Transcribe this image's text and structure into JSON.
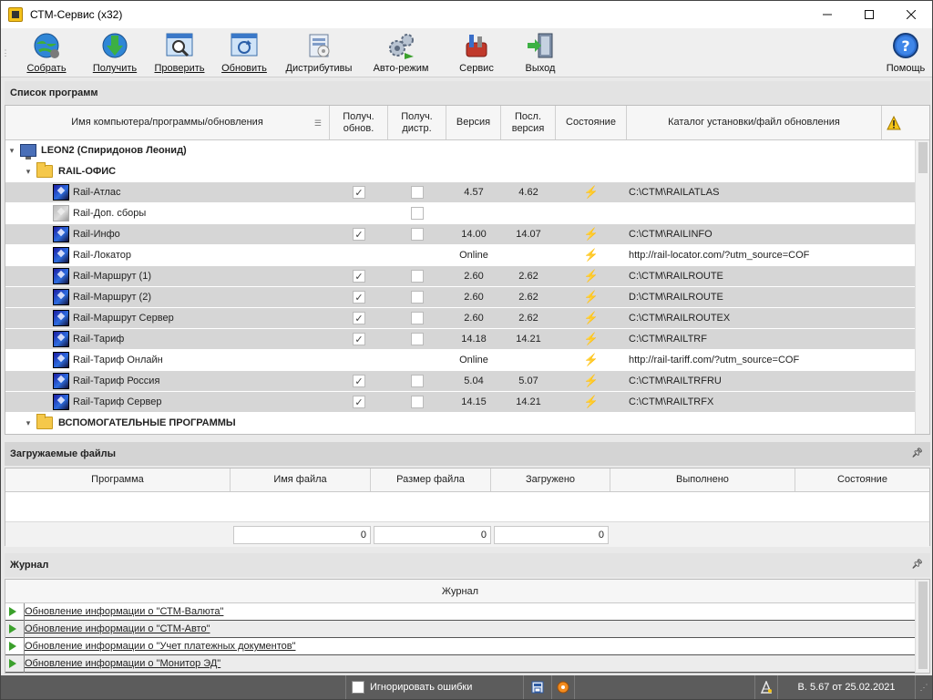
{
  "window": {
    "title": "СТМ-Сервис (x32)"
  },
  "toolbar": {
    "buttons": [
      {
        "label": "Собрать",
        "icon": "globe-collect-icon"
      },
      {
        "label": "Получить",
        "icon": "download-globe-icon"
      },
      {
        "label": "Проверить",
        "icon": "magnifier-window-icon"
      },
      {
        "label": "Обновить",
        "icon": "refresh-window-icon"
      },
      {
        "label": "Дистрибутивы",
        "icon": "distributive-box-icon"
      },
      {
        "label": "Авто-режим",
        "icon": "gears-auto-icon"
      },
      {
        "label": "Сервис",
        "icon": "tools-bag-icon"
      },
      {
        "label": "Выход",
        "icon": "exit-door-icon"
      },
      {
        "label": "Помощь",
        "icon": "help-question-icon"
      }
    ]
  },
  "programs_panel": {
    "title": "Список программ",
    "columns": {
      "name": "Имя компьютера/программы/обновления",
      "get_updates": "Получ. обнов.",
      "get_dist": "Получ. дистр.",
      "version": "Версия",
      "last_version": "Посл. версия",
      "state": "Состояние",
      "path": "Каталог установки/файл обновления"
    },
    "computer": "LEON2 (Спиридонов Леонид)",
    "group1": "RAIL-ОФИС",
    "group2": "ВСПОМОГАТЕЛЬНЫЕ ПРОГРАММЫ",
    "rows": [
      {
        "name": "Rail-Атлас",
        "upd": true,
        "dist": false,
        "version": "4.57",
        "last": "4.62",
        "state": "error",
        "path": "C:\\CTM\\RAILATLAS",
        "gray": false
      },
      {
        "name": "Rail-Доп. сборы",
        "upd": null,
        "dist": false,
        "version": "",
        "last": "",
        "state": "",
        "path": "",
        "gray": true
      },
      {
        "name": "Rail-Инфо",
        "upd": true,
        "dist": false,
        "version": "14.00",
        "last": "14.07",
        "state": "error",
        "path": "C:\\CTM\\RAILINFO",
        "gray": false
      },
      {
        "name": "Rail-Локатор",
        "upd": null,
        "dist": null,
        "version": "Online",
        "last": "",
        "state": "ok",
        "path": "http://rail-locator.com/?utm_source=COF",
        "gray": false
      },
      {
        "name": "Rail-Маршрут (1)",
        "upd": true,
        "dist": false,
        "version": "2.60",
        "last": "2.62",
        "state": "error",
        "path": "C:\\CTM\\RAILROUTE",
        "gray": false
      },
      {
        "name": "Rail-Маршрут (2)",
        "upd": true,
        "dist": false,
        "version": "2.60",
        "last": "2.62",
        "state": "error",
        "path": "D:\\CTM\\RAILROUTE",
        "gray": false
      },
      {
        "name": "Rail-Маршрут Сервер",
        "upd": true,
        "dist": false,
        "version": "2.60",
        "last": "2.62",
        "state": "error",
        "path": "C:\\CTM\\RAILROUTEX",
        "gray": false
      },
      {
        "name": "Rail-Тариф",
        "upd": true,
        "dist": false,
        "version": "14.18",
        "last": "14.21",
        "state": "error",
        "path": "C:\\CTM\\RAILTRF",
        "gray": false
      },
      {
        "name": "Rail-Тариф Онлайн",
        "upd": null,
        "dist": null,
        "version": "Online",
        "last": "",
        "state": "ok",
        "path": "http://rail-tariff.com/?utm_source=COF",
        "gray": false
      },
      {
        "name": "Rail-Тариф Россия",
        "upd": true,
        "dist": false,
        "version": "5.04",
        "last": "5.07",
        "state": "error",
        "path": "C:\\CTM\\RAILTRFRU",
        "gray": false
      },
      {
        "name": "Rail-Тариф Сервер",
        "upd": true,
        "dist": false,
        "version": "14.15",
        "last": "14.21",
        "state": "error",
        "path": "C:\\CTM\\RAILTRFX",
        "gray": false
      }
    ]
  },
  "downloads_panel": {
    "title": "Загружаемые файлы",
    "columns": [
      "Программа",
      "Имя файла",
      "Размер файла",
      "Загружено",
      "Выполнено",
      "Состояние"
    ],
    "totals": [
      "0",
      "0",
      "0"
    ]
  },
  "journal_panel": {
    "title": "Журнал",
    "column": "Журнал",
    "entries": [
      "Обновление информации о \"СТМ-Валюта\"",
      "Обновление информации о \"СТМ-Авто\"",
      "Обновление информации о \"Учет платежных документов\"",
      "Обновление информации о \"Монитор ЭД\""
    ]
  },
  "statusbar": {
    "ignore_errors_label": "Игнорировать ошибки",
    "version": "В. 5.67 от 25.02.2021"
  },
  "colors": {
    "error_state": "#d8262b",
    "ok_state": "#2a55c6",
    "play_icon": "#3ba02c",
    "statusbar_bg": "#5c5c5c"
  }
}
